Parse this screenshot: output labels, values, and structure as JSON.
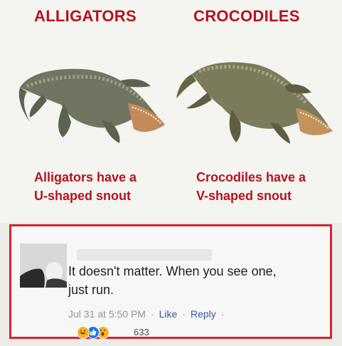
{
  "meme": {
    "left_title": "ALLIGATORS",
    "right_title": "CROCODILES",
    "left_caption_line1": "Alligators have a",
    "left_caption_line2": "U-shaped snout",
    "right_caption_line1": "Crocodiles have a",
    "right_caption_line2": "V-shaped snout"
  },
  "comment": {
    "text_line1": "It doesn't matter. When you see one,",
    "text_line2": "just run.",
    "timestamp": "Jul 31 at 5:50 PM",
    "like_label": "Like",
    "reply_label": "Reply",
    "dot": "·",
    "reaction_count": "633",
    "reaction_icons": [
      "haha-icon",
      "like-icon",
      "wow-icon"
    ]
  },
  "colors": {
    "title_red": "#b4141c",
    "border_red": "#d3262e",
    "link_blue": "#365899"
  }
}
